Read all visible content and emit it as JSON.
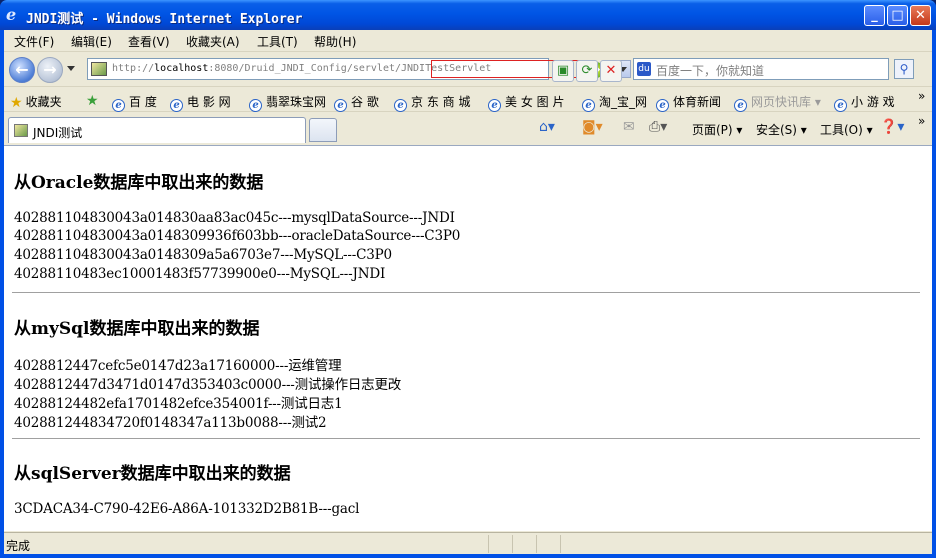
{
  "window": {
    "title": "JNDI测试 - Windows Internet Explorer"
  },
  "menubar": {
    "items": [
      "文件(F)",
      "编辑(E)",
      "查看(V)",
      "收藏夹(A)",
      "工具(T)",
      "帮助(H)"
    ]
  },
  "address": {
    "prefix": "http://",
    "host": "localhost",
    "path": ":8080/Druid_JNDI_Config/servlet/JNDITestServlet"
  },
  "search": {
    "placeholder": "百度一下，你就知道"
  },
  "favorites": {
    "label": "收藏夹",
    "items": [
      "百 度",
      "电 影 网",
      "翡翠珠宝网",
      "谷 歌",
      "京 东 商 城",
      "美 女 图 片",
      "淘_宝_网",
      "体育新闻",
      "网页快讯库",
      "小 游 戏"
    ]
  },
  "tab": {
    "title": "JNDI测试"
  },
  "commandbar": {
    "page": "页面(P)",
    "safety": "安全(S)",
    "tools": "工具(O)"
  },
  "content": {
    "sections": [
      {
        "heading": "从Oracle数据库中取出来的数据",
        "rows": [
          "402881104830043a014830aa83ac045c---mysqlDataSource---JNDI",
          "402881104830043a0148309936f603bb---oracleDataSource---C3P0",
          "402881104830043a0148309a5a6703e7---MySQL---C3P0",
          "40288110483ec10001483f57739900e0---MySQL---JNDI"
        ]
      },
      {
        "heading": "从mySql数据库中取出来的数据",
        "rows": [
          "4028812447cefc5e0147d23a17160000---运维管理",
          "4028812447d3471d0147d353403c0000---测试操作日志更改",
          "40288124482efa1701482efce354001f---测试日志1",
          "402881244834720f0148347a113b0088---测试2"
        ]
      },
      {
        "heading": "从sqlServer数据库中取出来的数据",
        "rows": [
          "3CDACA34-C790-42E6-A86A-101332D2B81B---gacl"
        ]
      }
    ]
  },
  "status": {
    "text": "完成"
  }
}
